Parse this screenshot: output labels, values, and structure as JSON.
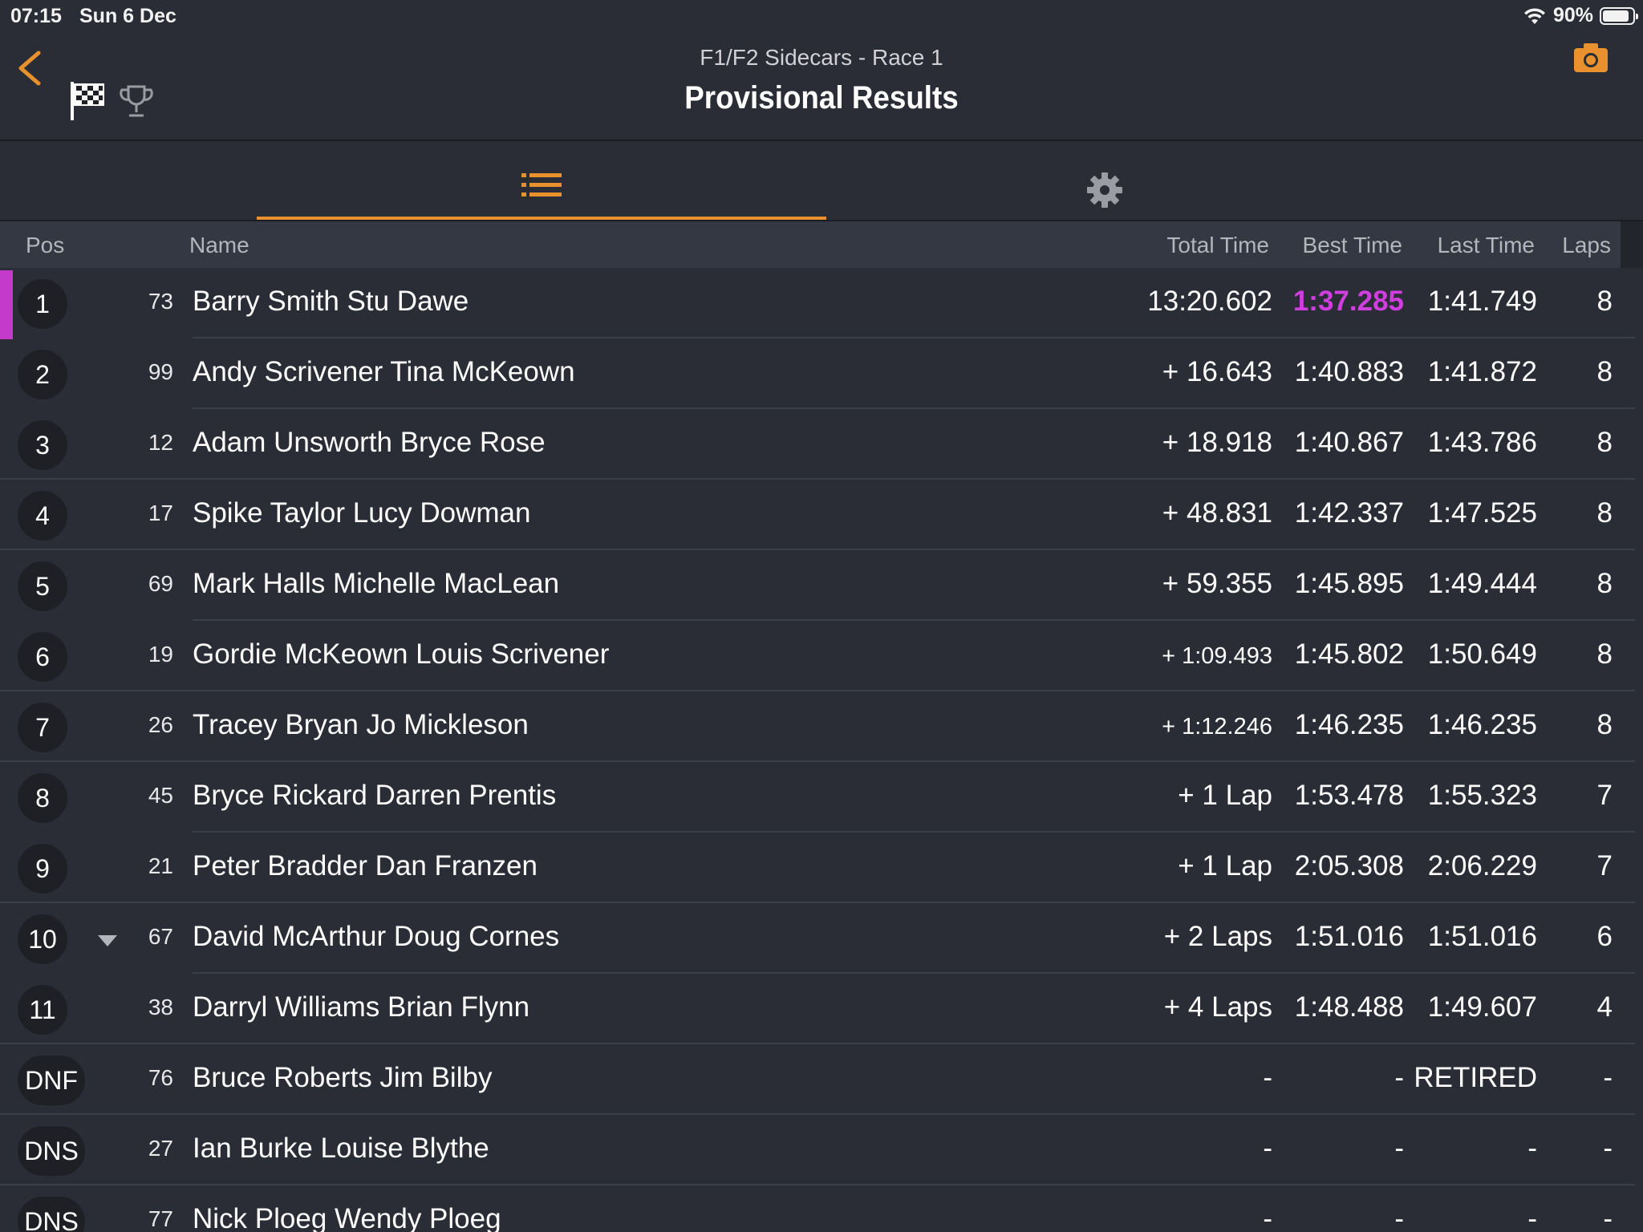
{
  "status_bar": {
    "time": "07:15",
    "date": "Sun 6 Dec",
    "battery": "90%",
    "battery_level": 0.9
  },
  "header": {
    "subtitle": "F1/F2 Sidecars - Race 1",
    "title": "Provisional Results"
  },
  "icons": {
    "back": "chevron-left-icon",
    "flag": "checkered-flag-icon",
    "trophy": "trophy-icon",
    "camera": "camera-icon",
    "list": "list-icon",
    "settings": "gear-icon"
  },
  "colors": {
    "accent": "#e8912e",
    "fastest": "#d03ee0",
    "background": "#2a2d36"
  },
  "columns": {
    "pos": "Pos",
    "name": "Name",
    "total": "Total Time",
    "best": "Best Time",
    "last": "Last Time",
    "laps": "Laps"
  },
  "results": [
    {
      "pos": "1",
      "num": "73",
      "name": "Barry Smith Stu Dawe",
      "total": "13:20.602",
      "best": "1:37.285",
      "last": "1:41.749",
      "laps": "8"
    },
    {
      "pos": "2",
      "num": "99",
      "name": "Andy Scrivener Tina McKeown",
      "total": "+ 16.643",
      "best": "1:40.883",
      "last": "1:41.872",
      "laps": "8"
    },
    {
      "pos": "3",
      "num": "12",
      "name": "Adam Unsworth Bryce Rose",
      "total": "+ 18.918",
      "best": "1:40.867",
      "last": "1:43.786",
      "laps": "8"
    },
    {
      "pos": "4",
      "num": "17",
      "name": "Spike Taylor Lucy Dowman",
      "total": "+ 48.831",
      "best": "1:42.337",
      "last": "1:47.525",
      "laps": "8"
    },
    {
      "pos": "5",
      "num": "69",
      "name": "Mark Halls Michelle MacLean",
      "total": "+ 59.355",
      "best": "1:45.895",
      "last": "1:49.444",
      "laps": "8"
    },
    {
      "pos": "6",
      "num": "19",
      "name": "Gordie McKeown Louis Scrivener",
      "total": "+ 1:09.493",
      "best": "1:45.802",
      "last": "1:50.649",
      "laps": "8"
    },
    {
      "pos": "7",
      "num": "26",
      "name": "Tracey Bryan Jo Mickleson",
      "total": "+ 1:12.246",
      "best": "1:46.235",
      "last": "1:46.235",
      "laps": "8"
    },
    {
      "pos": "8",
      "num": "45",
      "name": "Bryce Rickard Darren Prentis",
      "total": "+ 1 Lap",
      "best": "1:53.478",
      "last": "1:55.323",
      "laps": "7"
    },
    {
      "pos": "9",
      "num": "21",
      "name": "Peter Bradder Dan Franzen",
      "total": "+ 1 Lap",
      "best": "2:05.308",
      "last": "2:06.229",
      "laps": "7"
    },
    {
      "pos": "10",
      "num": "67",
      "name": "David McArthur Doug Cornes",
      "total": "+ 2 Laps",
      "best": "1:51.016",
      "last": "1:51.016",
      "laps": "6"
    },
    {
      "pos": "11",
      "num": "38",
      "name": "Darryl Williams Brian Flynn",
      "total": "+ 4 Laps",
      "best": "1:48.488",
      "last": "1:49.607",
      "laps": "4"
    },
    {
      "pos": "DNF",
      "num": "76",
      "name": "Bruce Roberts Jim Bilby",
      "total": "-",
      "best": "-",
      "last": "RETIRED",
      "laps": "-"
    },
    {
      "pos": "DNS",
      "num": "27",
      "name": "Ian Burke Louise Blythe",
      "total": "-",
      "best": "-",
      "last": "-",
      "laps": "-"
    },
    {
      "pos": "DNS",
      "num": "77",
      "name": "Nick Ploeg Wendy Ploeg",
      "total": "-",
      "best": "-",
      "last": "-",
      "laps": "-"
    }
  ]
}
